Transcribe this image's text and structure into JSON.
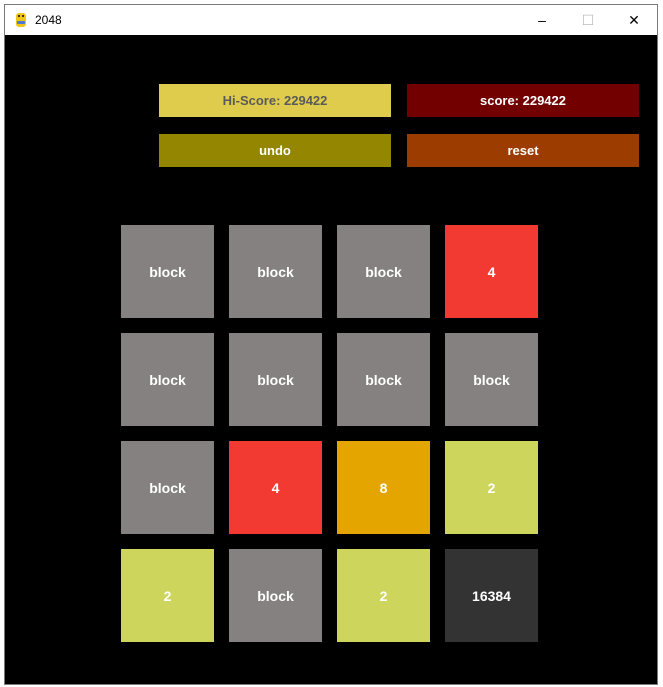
{
  "window": {
    "title": "2048",
    "controls": {
      "minimize": "–",
      "maximize": "☐",
      "close": "✕"
    }
  },
  "header": {
    "hi_score_label": "Hi-Score: 229422",
    "score_label": "score: 229422",
    "undo_label": "undo",
    "reset_label": "reset"
  },
  "colors": {
    "hi_score_bg": "#e0cc4c",
    "hi_score_text": "#5a5a5a",
    "score_bg": "#730000",
    "undo_bg": "#948600",
    "reset_bg": "#9c3c00",
    "block": "#858180",
    "tile_2": "#cdd55c",
    "tile_4": "#f23a33",
    "tile_8": "#e4a500",
    "tile_16384": "#333333"
  },
  "board": {
    "rows": [
      [
        "block",
        "block",
        "block",
        "4"
      ],
      [
        "block",
        "block",
        "block",
        "block"
      ],
      [
        "block",
        "4",
        "8",
        "2"
      ],
      [
        "2",
        "block",
        "2",
        "16384"
      ]
    ]
  }
}
